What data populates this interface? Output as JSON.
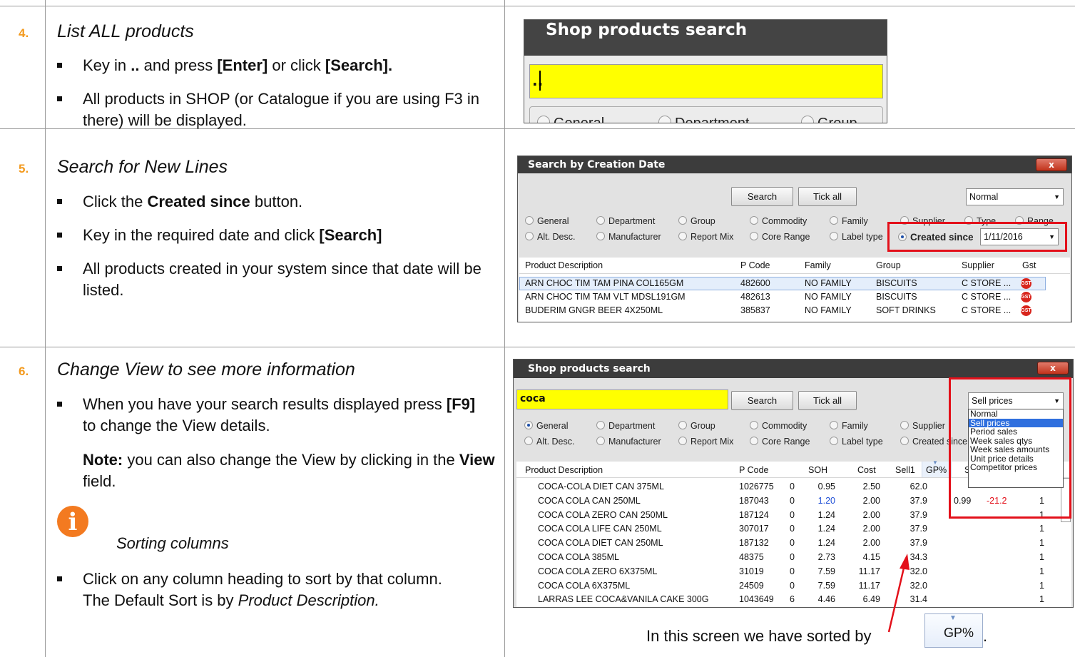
{
  "sections": [
    {
      "number": "4.",
      "heading": "List ALL products",
      "bullet1": [
        "Key in ",
        "..",
        " and press ",
        "[Enter]",
        " or click ",
        "[Search]."
      ],
      "bullet2": "All products in SHOP (or Catalogue if you are using F3 in there) will be displayed."
    },
    {
      "number": "5.",
      "heading": "Search for New Lines",
      "bullet1": [
        "Click the ",
        "Created since",
        " button."
      ],
      "bullet2": [
        "Key in the required date and click ",
        "[Search]"
      ],
      "bullet3": "All products created in your system since that date will be listed."
    },
    {
      "number": "6.",
      "heading": "Change View to see more information",
      "bullet1": [
        "When you have your search results displayed press ",
        "[F9]",
        " to change the View details."
      ],
      "note": [
        "Note:",
        "  you can also change the View by clicking in the ",
        "View",
        " field."
      ],
      "info_caption": "Sorting columns",
      "bullet2": [
        "Click on any column heading to sort by that column.  The Default Sort is by ",
        "Product Description."
      ]
    }
  ],
  "screen1": {
    "title": "Shop products search",
    "input_value": "..",
    "radio_partial": [
      "General",
      "Department",
      "Group"
    ]
  },
  "screen2": {
    "title": "Search by Creation Date",
    "close": "x",
    "search_btn": "Search",
    "tickall_btn": "Tick all",
    "view_select": "Normal",
    "radios_row1": [
      "General",
      "Department",
      "Group",
      "Commodity",
      "Family",
      "Supplier",
      "Type",
      "Range"
    ],
    "radios_row2": [
      "Alt. Desc.",
      "Manufacturer",
      "Report Mix",
      "Core Range",
      "Label type",
      "Created since"
    ],
    "date_value": "1/11/2016",
    "columns": [
      "Product Description",
      "P Code",
      "Family",
      "Group",
      "Supplier",
      "Gst"
    ],
    "rows": [
      [
        "ARN CHOC TIM TAM PINA COL165GM",
        "482600",
        "NO FAMILY",
        "BISCUITS",
        "C STORE ..."
      ],
      [
        "ARN CHOC TIM TAM VLT MDSL191GM",
        "482613",
        "NO FAMILY",
        "BISCUITS",
        "C STORE ..."
      ],
      [
        "BUDERIM GNGR BEER    4X250ML",
        "385837",
        "NO FAMILY",
        "SOFT DRINKS",
        "C STORE ..."
      ]
    ],
    "gst_icon": "GST"
  },
  "screen3": {
    "title": "Shop products search",
    "close": "x",
    "search_value": "coca",
    "search_btn": "Search",
    "tickall_btn": "Tick all",
    "view_select": "Sell prices",
    "dropdown_options": [
      "Normal",
      "Sell prices",
      "Period sales",
      "Week sales qtys",
      "Week sales amounts",
      "Unit price details",
      "Competitor prices"
    ],
    "radios_row1": [
      "General",
      "Department",
      "Group",
      "Commodity",
      "Family",
      "Supplier"
    ],
    "radios_row2": [
      "Alt. Desc.",
      "Manufacturer",
      "Report Mix",
      "Core Range",
      "Label type",
      "Created since"
    ],
    "columns": [
      "Product Description",
      "P Code",
      "SOH",
      "Cost",
      "Sell1",
      "GP%",
      "Sp"
    ],
    "rows": [
      [
        "COCA-COLA DIET CAN 375ML",
        "1026775",
        "0",
        "0.95",
        "2.50",
        "62.0"
      ],
      [
        "COCA COLA CAN          250ML",
        "187043",
        "0",
        "1.20",
        "2.00",
        "37.9"
      ],
      [
        "COCA COLA ZERO CAN     250ML",
        "187124",
        "0",
        "1.24",
        "2.00",
        "37.9"
      ],
      [
        "COCA COLA LIFE CAN     250ML",
        "307017",
        "0",
        "1.24",
        "2.00",
        "37.9"
      ],
      [
        "COCA COLA DIET CAN     250ML",
        "187132",
        "0",
        "1.24",
        "2.00",
        "37.9"
      ],
      [
        "COCA COLA              385ML",
        "48375",
        "0",
        "2.73",
        "4.15",
        "34.3"
      ],
      [
        "COCA COLA ZERO      6X375ML",
        "31019",
        "0",
        "7.59",
        "11.17",
        "32.0"
      ],
      [
        "COCA COLA           6X375ML",
        "24509",
        "0",
        "7.59",
        "11.17",
        "32.0"
      ],
      [
        "LARRAS LEE COCA&VANILA CAKE 300G",
        "1043649",
        "6",
        "4.46",
        "6.49",
        "31.4"
      ]
    ],
    "row2_extra": [
      "0.99",
      "-21.2"
    ],
    "tail_col": [
      "",
      "1",
      "1",
      "1",
      "1",
      "1",
      "1",
      "1",
      "1"
    ],
    "caption": "In this screen we have sorted by",
    "gp_button": "GP%",
    "period": "."
  },
  "colors": {
    "accent_number": "#f39a1e",
    "highlight": "#e3101a",
    "title_bar": "#3c3c3c",
    "input_yellow": "#ffff00",
    "select_blue": "#2f6fde"
  }
}
